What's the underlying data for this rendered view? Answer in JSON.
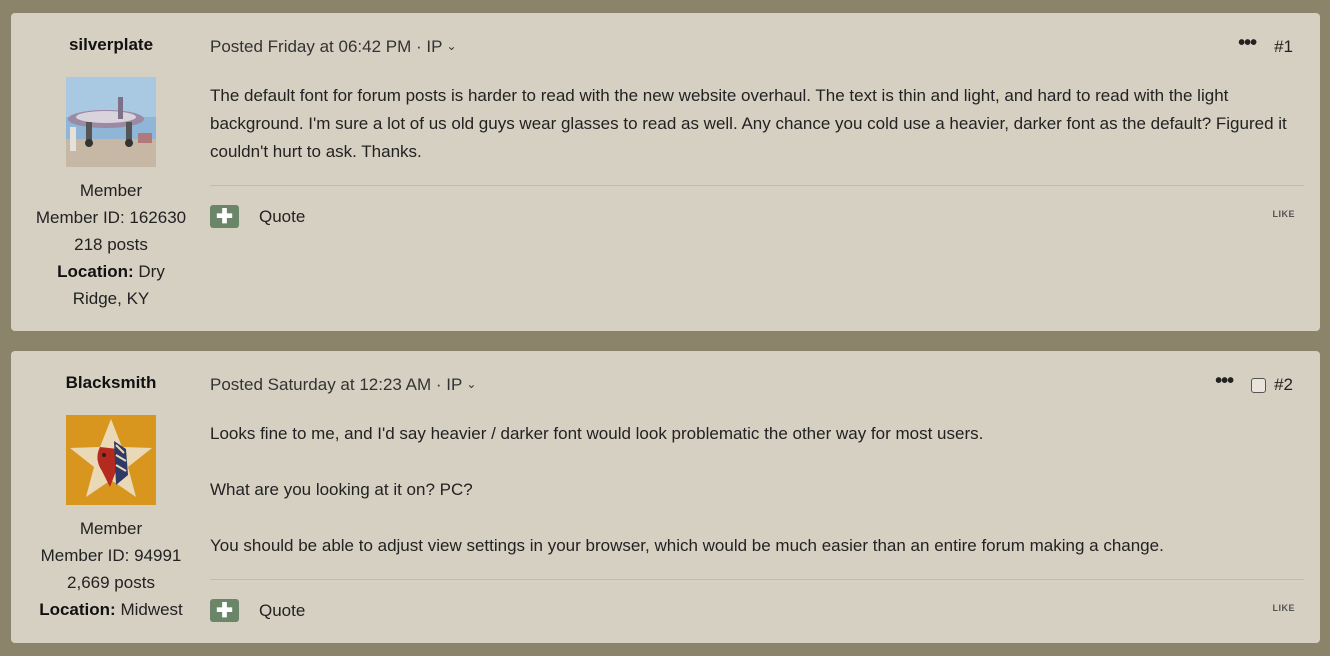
{
  "posts": [
    {
      "username": "silverplate",
      "role": "Member",
      "member_id": "Member ID: 162630",
      "post_count": "218 posts",
      "location_label": "Location:",
      "location_value_line1": "Dry",
      "location_value_line2": "Ridge, KY",
      "meta": "Posted Friday at 06:42 PM · IP",
      "more_icon": "ellipsis-icon",
      "number": "#1",
      "body": "The default font for forum posts is harder to read with the new website overhaul. The text is thin and light, and hard to read with the light background. I'm sure a lot of us old guys wear glasses to read as well. Any chance you cold use a heavier, darker font as the default? Figured it couldn't hurt to ask. Thanks.",
      "quote_label": "Quote",
      "like_label": "LIKE"
    },
    {
      "username": "Blacksmith",
      "role": "Member",
      "member_id": "Member ID: 94991",
      "post_count": "2,669 posts",
      "location_label": "Location:",
      "location_value": "Midwest",
      "meta": "Posted Saturday at 12:23 AM · IP",
      "more_icon": "ellipsis-icon",
      "number": "#2",
      "body_paragraphs": [
        "Looks fine to me, and I'd say heavier / darker font would look problematic the other way for most users.",
        "What are you looking at it on?  PC?",
        "You should be able to adjust view settings in your browser, which would be much easier than an entire forum making a change."
      ],
      "quote_label": "Quote",
      "like_label": "LIKE"
    }
  ],
  "colors": {
    "page_background": "#8c836b",
    "post_background": "#d6d0c3",
    "button_green": "#6b8568"
  }
}
